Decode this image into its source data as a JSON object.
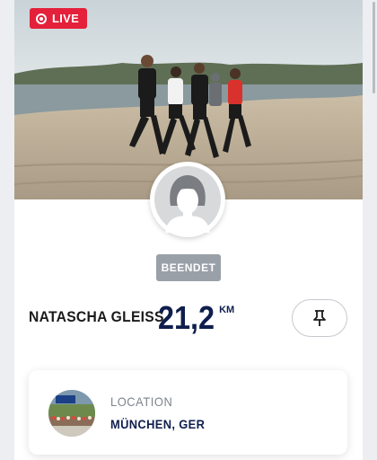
{
  "live_badge": {
    "label": "LIVE"
  },
  "runner": {
    "name": "NATASCHA GLEISS",
    "distance_value": "21,2",
    "distance_unit": "KM",
    "status": "BEENDET"
  },
  "location": {
    "label": "LOCATION",
    "value": "MÜNCHEN, GER"
  },
  "colors": {
    "live_red": "#e4203a",
    "navy": "#0f1e4d",
    "status_gray": "#9aa0a8"
  },
  "icons": {
    "pin": "pin-icon",
    "avatar": "avatar-placeholder-icon"
  }
}
